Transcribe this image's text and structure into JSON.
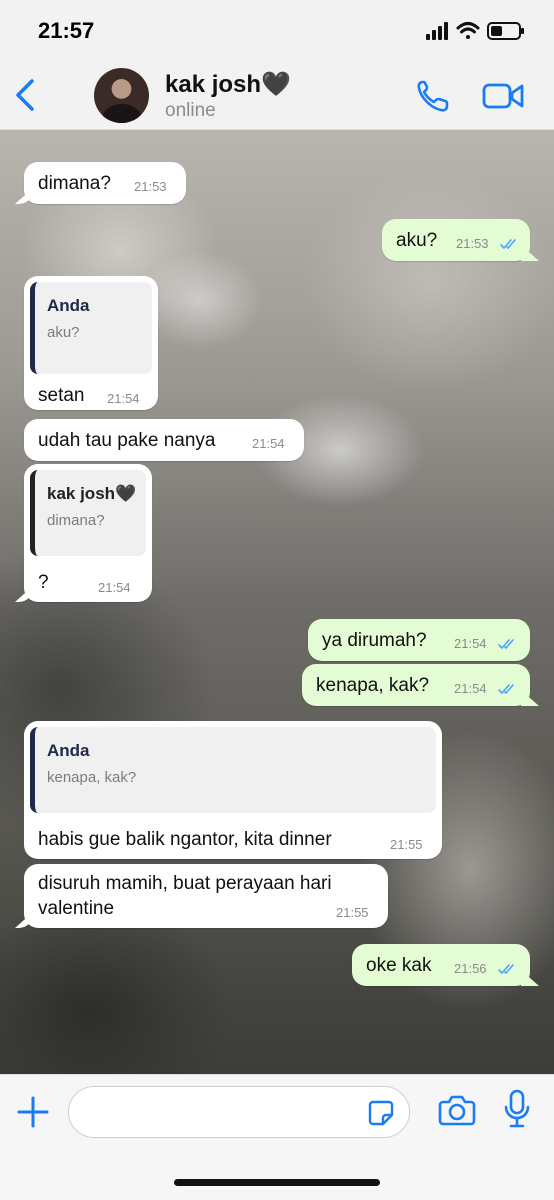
{
  "status_bar": {
    "time": "21:57"
  },
  "header": {
    "contact_name": "kak josh🖤",
    "contact_status": "online",
    "icons": {
      "back": "chevron-left-icon",
      "call": "phone-icon",
      "video": "video-camera-icon"
    }
  },
  "colors": {
    "accent": "#1a7cf5",
    "incoming_bubble": "#ffffff",
    "outgoing_bubble": "#e3fcd4",
    "read_ticks": "#4fa3ff",
    "quote_bar": "#1f2a4a"
  },
  "messages": [
    {
      "direction": "in",
      "text": "dimana?",
      "time": "21:53"
    },
    {
      "direction": "out",
      "text": "aku?",
      "time": "21:53",
      "read": true
    },
    {
      "direction": "in",
      "quote_author": "Anda",
      "quote_text": "aku?",
      "text": "setan",
      "time": "21:54"
    },
    {
      "direction": "in",
      "text": "udah tau pake nanya",
      "time": "21:54"
    },
    {
      "direction": "in",
      "quote_author": "kak josh🖤",
      "quote_text": "dimana?",
      "text": "?",
      "time": "21:54"
    },
    {
      "direction": "out",
      "text": "ya dirumah?",
      "time": "21:54",
      "read": true
    },
    {
      "direction": "out",
      "text": "kenapa, kak?",
      "time": "21:54",
      "read": true
    },
    {
      "direction": "in",
      "quote_author": "Anda",
      "quote_text": "kenapa, kak?",
      "text": "habis gue balik ngantor, kita dinner",
      "time": "21:55"
    },
    {
      "direction": "in",
      "text_line1": "disuruh mamih, buat perayaan hari",
      "text_line2": "valentine",
      "time": "21:55"
    },
    {
      "direction": "out",
      "text": "oke kak",
      "time": "21:56",
      "read": true
    }
  ],
  "composer": {
    "placeholder": "",
    "icons": {
      "plus": "plus-icon",
      "sticker": "sticker-icon",
      "camera": "camera-icon",
      "mic": "microphone-icon"
    }
  }
}
